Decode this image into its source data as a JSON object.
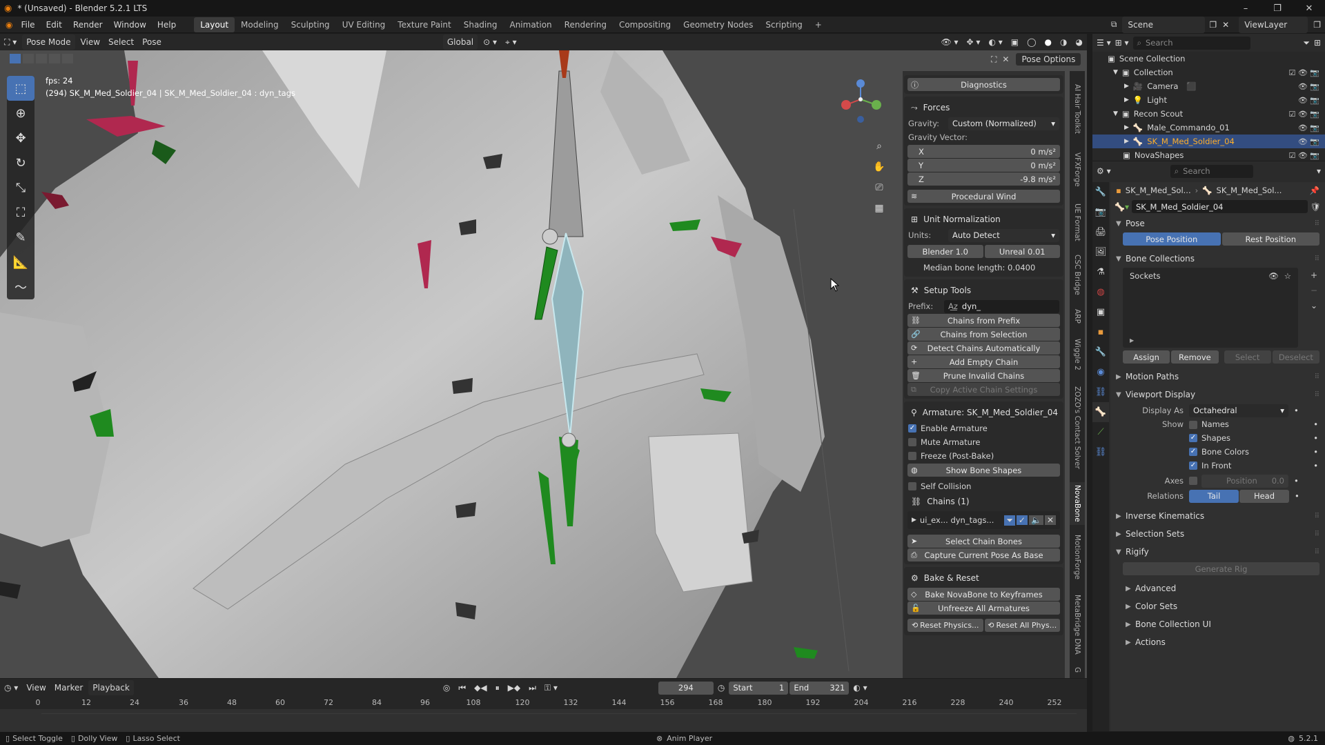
{
  "app": {
    "title": "* (Unsaved) - Blender 5.2.1 LTS",
    "version": "5.2.1"
  },
  "menu": [
    "File",
    "Edit",
    "Render",
    "Window",
    "Help"
  ],
  "workspaces": [
    "Layout",
    "Modeling",
    "Sculpting",
    "UV Editing",
    "Texture Paint",
    "Shading",
    "Animation",
    "Rendering",
    "Compositing",
    "Geometry Nodes",
    "Scripting"
  ],
  "active_workspace": "Layout",
  "scene": {
    "name": "Scene",
    "view_layer": "ViewLayer"
  },
  "viewport": {
    "mode": "Pose Mode",
    "menus": [
      "View",
      "Select",
      "Pose"
    ],
    "orientation": "Global",
    "pose_options": "Pose Options",
    "fps": "fps: 24",
    "info": "(294) SK_M_Med_Soldier_04 | SK_M_Med_Soldier_04 : dyn_tags"
  },
  "npanel": {
    "diagnostics": "Diagnostics",
    "forces": {
      "title": "Forces",
      "gravity_label": "Gravity:",
      "gravity_value": "Custom (Normalized)",
      "vector_label": "Gravity Vector:",
      "x_label": "X",
      "x": "0 m/s²",
      "y_label": "Y",
      "y": "0 m/s²",
      "z_label": "Z",
      "z": "-9.8 m/s²",
      "wind": "Procedural Wind"
    },
    "unit": {
      "title": "Unit Normalization",
      "units_label": "Units:",
      "units_value": "Auto Detect",
      "blender_btn": "Blender 1.0",
      "unreal_btn": "Unreal 0.01",
      "median": "Median bone length: 0.0400"
    },
    "setup": {
      "title": "Setup Tools",
      "prefix_label": "Prefix:",
      "prefix_value": "dyn_",
      "buttons": [
        "Chains from Prefix",
        "Chains from Selection",
        "Detect Chains Automatically",
        "Add Empty Chain",
        "Prune Invalid Chains",
        "Copy Active Chain Settings"
      ]
    },
    "armature": {
      "title": "Armature: SK_M_Med_Soldier_04",
      "enable": "Enable Armature",
      "mute": "Mute Armature",
      "freeze": "Freeze (Post-Bake)",
      "show_shapes": "Show Bone Shapes",
      "self_collision": "Self Collision",
      "chains_title": "Chains (1)",
      "chain_item": "ui_ex... dyn_tags...",
      "select_bones": "Select Chain Bones",
      "capture": "Capture Current Pose As Base"
    },
    "bake": {
      "title": "Bake & Reset",
      "bake_btn": "Bake NovaBone to Keyframes",
      "unfreeze": "Unfreeze All Armatures",
      "reset_physics": "Reset Physics...",
      "reset_all": "Reset All Phys..."
    }
  },
  "sidetabs": [
    "AI Hair Toolkit",
    "VFXForge",
    "UE Format",
    "CSC Bridge",
    "ARP",
    "Wiggle 2",
    "ZOZO's Contact Solver",
    "NovaBone",
    "MotionForge",
    "MetaBridge DNA",
    "G"
  ],
  "active_sidetab": "NovaBone",
  "timeline": {
    "menus": [
      "View",
      "Marker",
      "Playback"
    ],
    "current_frame": "294",
    "start_label": "Start",
    "start": "1",
    "end_label": "End",
    "end": "321",
    "ticks": [
      "0",
      "12",
      "24",
      "36",
      "48",
      "60",
      "72",
      "84",
      "96",
      "108",
      "120",
      "132",
      "144",
      "156",
      "168",
      "180",
      "192",
      "204",
      "216",
      "228",
      "240",
      "252"
    ]
  },
  "statusbar": {
    "left": [
      "Select Toggle",
      "Dolly View",
      "Lasso Select"
    ],
    "center": "Anim Player",
    "version": "5.2.1"
  },
  "outliner": {
    "search": "Search",
    "items": [
      {
        "name": "Scene Collection",
        "depth": 0
      },
      {
        "name": "Collection",
        "depth": 1
      },
      {
        "name": "Camera",
        "depth": 2
      },
      {
        "name": "Light",
        "depth": 2
      },
      {
        "name": "Recon Scout",
        "depth": 1
      },
      {
        "name": "Male_Commando_01",
        "depth": 2
      },
      {
        "name": "SK_M_Med_Soldier_04",
        "depth": 2,
        "selected": true
      },
      {
        "name": "NovaShapes",
        "depth": 1
      }
    ]
  },
  "properties": {
    "search": "Search",
    "breadcrumb": [
      "SK_M_Med_Sol...",
      "SK_M_Med_Sol..."
    ],
    "datablock": "SK_M_Med_Soldier_04",
    "pose": {
      "title": "Pose",
      "pose_position": "Pose Position",
      "rest_position": "Rest Position"
    },
    "bone_collections": {
      "title": "Bone Collections",
      "item": "Sockets",
      "assign": "Assign",
      "remove": "Remove",
      "select": "Select",
      "deselect": "Deselect"
    },
    "motion_paths": "Motion Paths",
    "viewport_display": {
      "title": "Viewport Display",
      "display_as_label": "Display As",
      "display_as": "Octahedral",
      "show_label": "Show",
      "names": "Names",
      "shapes": "Shapes",
      "bone_colors": "Bone Colors",
      "in_front": "In Front",
      "axes_label": "Axes",
      "position_label": "Position",
      "position_value": "0.0",
      "relations_label": "Relations",
      "tail": "Tail",
      "head": "Head"
    },
    "inverse_kinematics": "Inverse Kinematics",
    "selection_sets": "Selection Sets",
    "rigify": {
      "title": "Rigify",
      "generate": "Generate Rig",
      "advanced": "Advanced",
      "color_sets": "Color Sets",
      "bone_collection_ui": "Bone Collection UI",
      "actions": "Actions"
    }
  },
  "colors": {
    "accent": "#4772b3",
    "bone_green": "#1f8a1f",
    "bone_red": "#b0284f",
    "bone_active": "#c8e8ee"
  }
}
